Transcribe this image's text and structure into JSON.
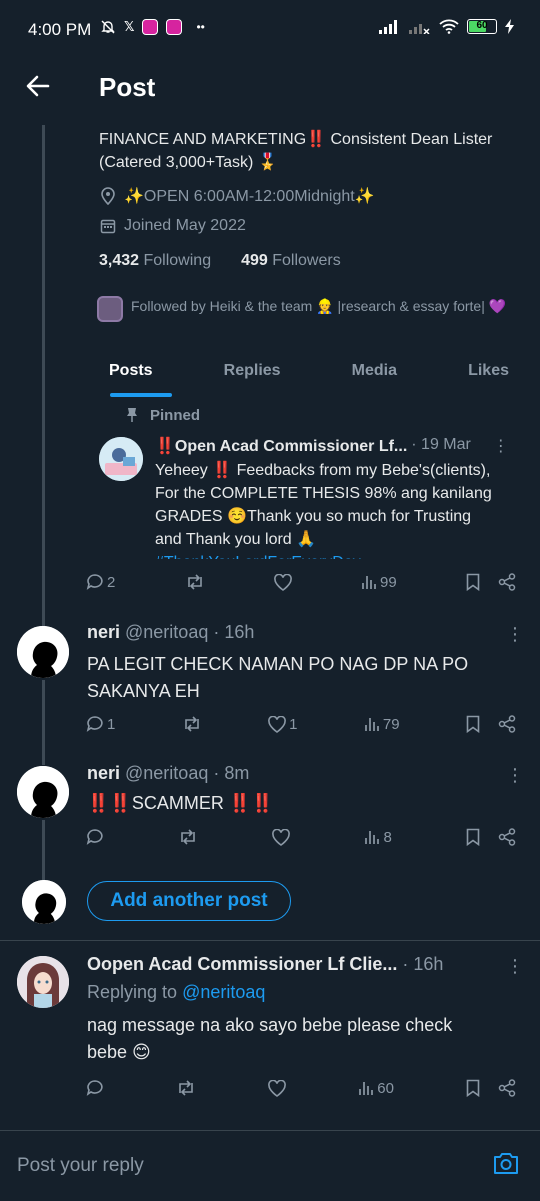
{
  "status": {
    "time": "4:00 PM",
    "battery": "60",
    "overflow_dots": "••"
  },
  "header": {
    "title": "Post"
  },
  "profile": {
    "bio_line1": "FINANCE AND MARKETING‼️ Consistent Dean Lister",
    "bio_line2": "(Catered 3,000+Task) 🎖️",
    "location": "✨OPEN 6:00AM-12:00Midnight✨",
    "joined": "Joined May 2022",
    "following_count": "3,432",
    "following_label": "Following",
    "followers_count": "499",
    "followers_label": "Followers",
    "followed_by": "Followed by Heiki & the team 👷 |research & essay forte| 💜"
  },
  "tabs": [
    "Posts",
    "Replies",
    "Media",
    "Likes"
  ],
  "pinned": {
    "label": "Pinned",
    "author": "‼️Open Acad Commissioner Lf...",
    "date": "· 19 Mar",
    "text_line1": "Yeheey ‼️ Feedbacks from my Bebe's(clients),",
    "text_line2": "For the COMPLETE THESIS 98%  ang kanilang",
    "text_line3": "GRADES ☺️Thank you so much for Trusting",
    "text_line4": "and Thank you lord 🙏",
    "hashtag": "#ThankYouLordForEveryDay",
    "replies": "2",
    "views": "99"
  },
  "reply1": {
    "name": "neri",
    "handle": "@neritoaq",
    "time": "· 16h",
    "text_line1": "PA LEGIT CHECK NAMAN PO NAG DP NA PO",
    "text_line2": "SAKANYA EH",
    "replies": "1",
    "likes": "1",
    "views": "79"
  },
  "reply2": {
    "name": "neri",
    "handle": "@neritoaq",
    "time": "· 8m",
    "text": "‼️‼️SCAMMER ‼️‼️",
    "views": "8"
  },
  "add_post": {
    "label": "Add another post"
  },
  "reply3": {
    "name": "Oopen Acad Commissioner Lf Clie...",
    "time": "· 16h",
    "replying_prefix": "Replying to",
    "replying_handle": "@neritoaq",
    "text_line1": "nag message na ako sayo bebe please check",
    "text_line2": "bebe 😊",
    "views": "60"
  },
  "composer": {
    "placeholder": "Post your reply"
  },
  "colors": {
    "background": "#15202b",
    "accent": "#1d9bf0",
    "muted": "#8b98a5"
  }
}
